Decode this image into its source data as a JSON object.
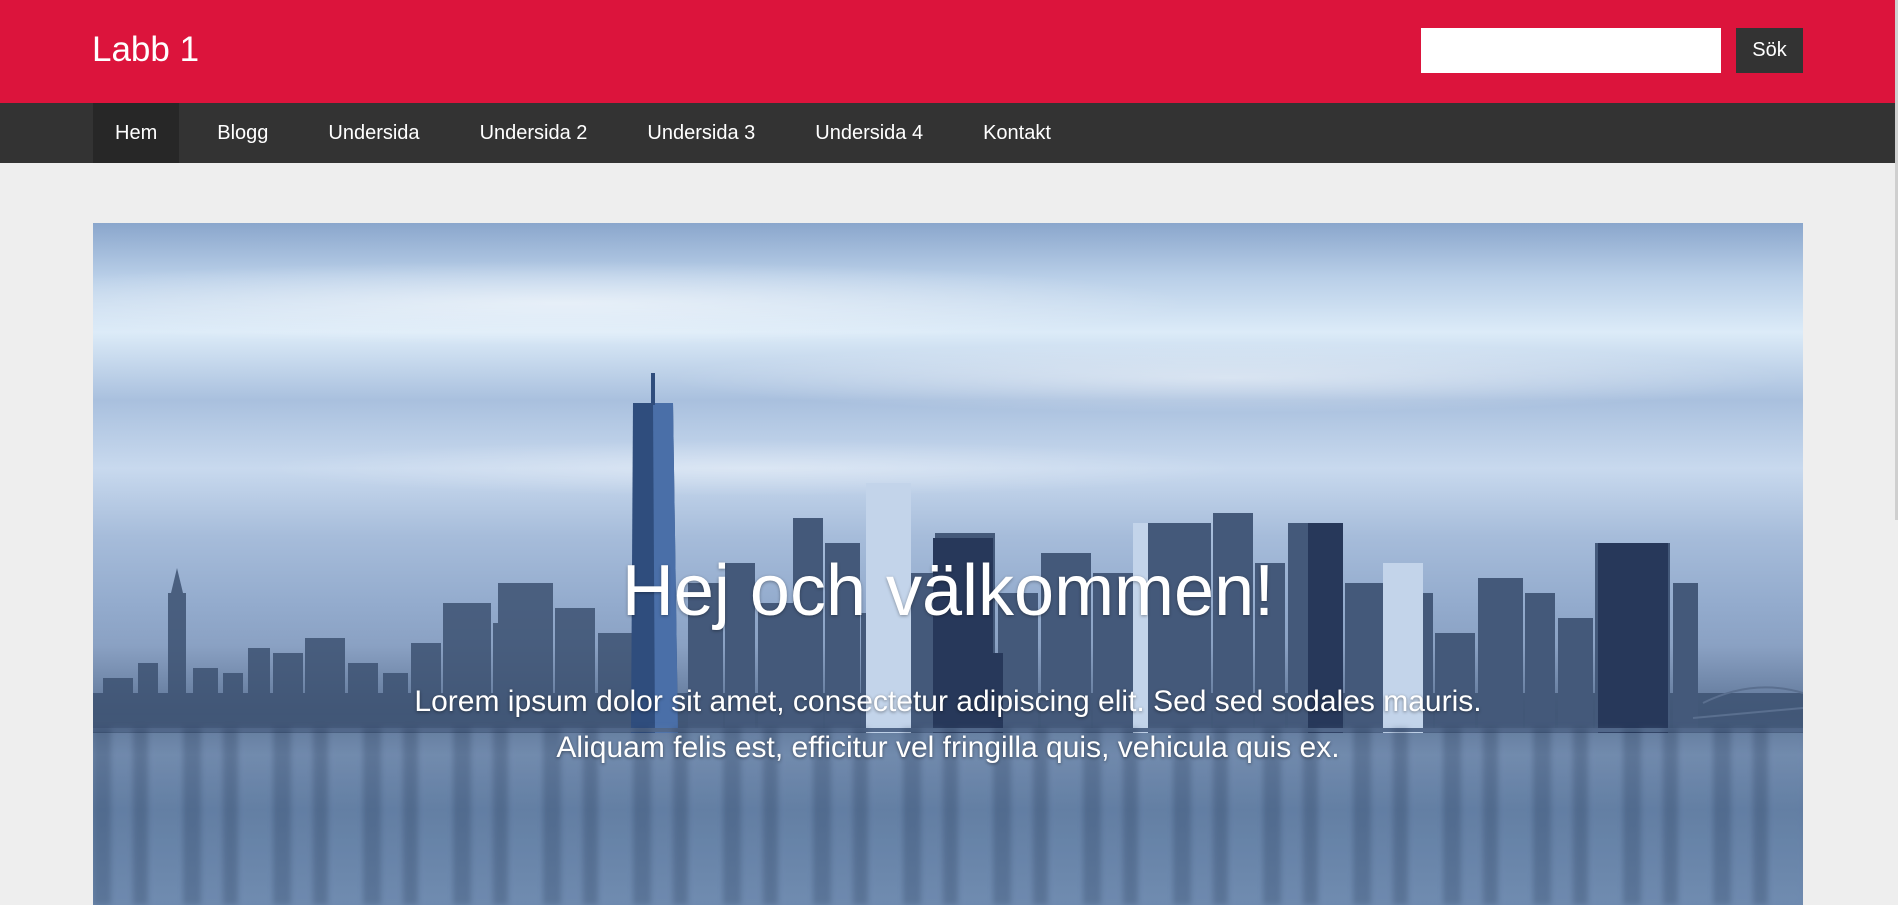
{
  "header": {
    "site_title": "Labb 1",
    "search_placeholder": "",
    "search_button_label": "Sök",
    "background_color": "#dc143c"
  },
  "nav": {
    "items": [
      {
        "label": "Hem",
        "active": true
      },
      {
        "label": "Blogg"
      },
      {
        "label": "Undersida"
      },
      {
        "label": "Undersida 2"
      },
      {
        "label": "Undersida 3"
      },
      {
        "label": "Undersida 4"
      },
      {
        "label": "Kontakt"
      }
    ],
    "background_color": "#333333"
  },
  "hero": {
    "heading": "Hej och välkommen!",
    "text": "Lorem ipsum dolor sit amet, consectetur adipiscing elit. Sed sed sodales mauris. Aliquam felis est, efficitur vel fringilla quis, vehicula quis ex.",
    "image": "city-skyline-over-water"
  }
}
